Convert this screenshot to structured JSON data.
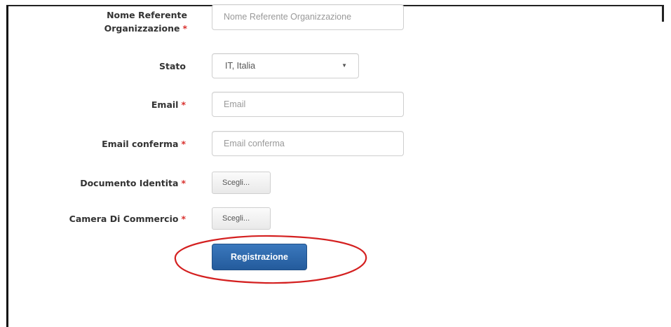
{
  "form": {
    "referente": {
      "label_line1": "Nome Referente",
      "label_line2": "Organizzazione",
      "required": "*",
      "placeholder": "Nome Referente Organizzazione"
    },
    "stato": {
      "label": "Stato",
      "selected": "IT, Italia"
    },
    "email": {
      "label": "Email",
      "required": "*",
      "placeholder": "Email"
    },
    "email_conferma": {
      "label": "Email conferma",
      "required": "*",
      "placeholder": "Email conferma"
    },
    "documento": {
      "label": "Documento Identita",
      "required": "*",
      "button": "Scegli..."
    },
    "camera": {
      "label": "Camera Di Commercio",
      "required": "*",
      "button": "Scegli..."
    },
    "submit_label": "Registrazione"
  },
  "colors": {
    "required": "#d9312e",
    "primary": "#2f6aad",
    "highlight_ellipse": "#d42020"
  }
}
